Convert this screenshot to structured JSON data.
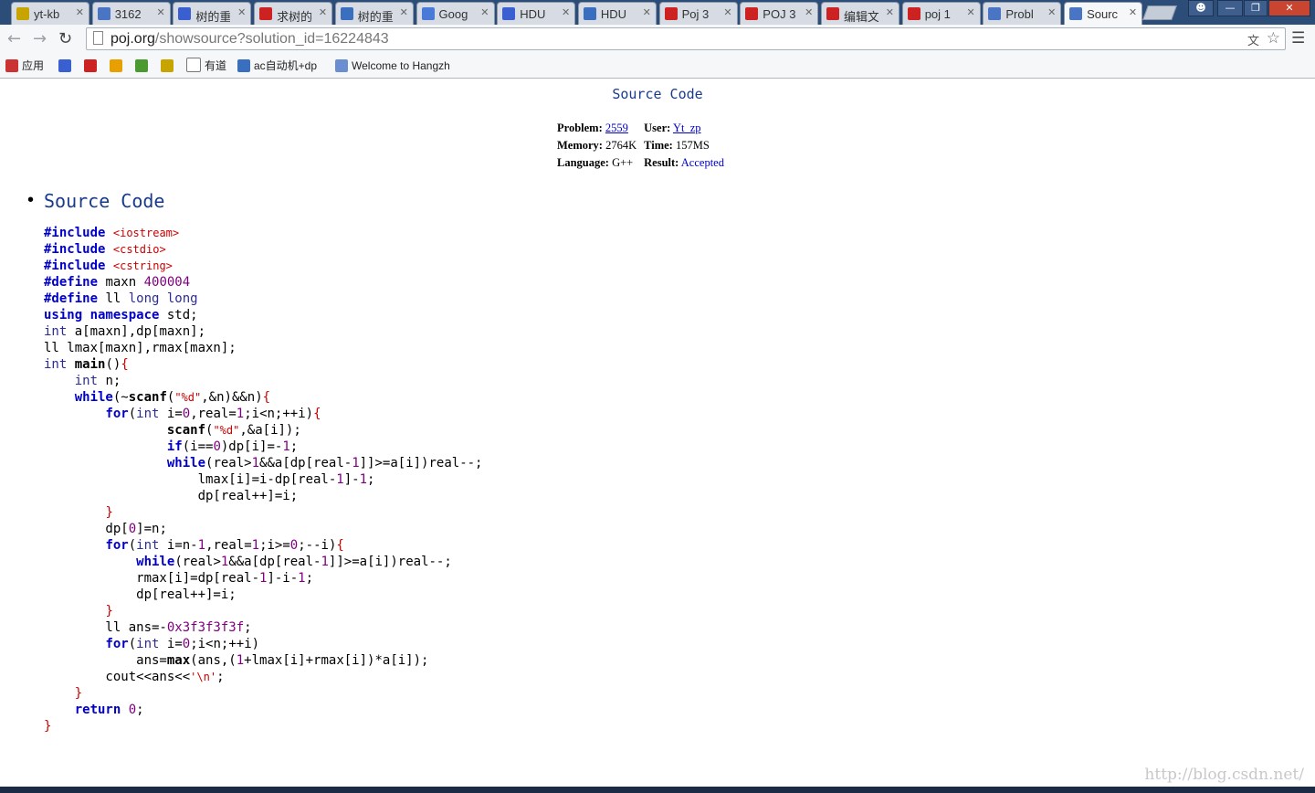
{
  "browser": {
    "tabs": [
      {
        "title": "yt-kb",
        "icon": "smiley-icon",
        "color": "#c8a400"
      },
      {
        "title": "3162",
        "icon": "poj-icon",
        "color": "#4a74c4"
      },
      {
        "title": "树的重",
        "icon": "paw-icon",
        "color": "#3a5fd0"
      },
      {
        "title": "求树的",
        "icon": "csdn-icon",
        "color": "#cc2222"
      },
      {
        "title": "树的重",
        "icon": "browser-icon",
        "color": "#3a6fc0"
      },
      {
        "title": "Goog",
        "icon": "google-translate-icon",
        "color": "#4a7ad8"
      },
      {
        "title": "HDU",
        "icon": "paw-icon",
        "color": "#3a5fd0"
      },
      {
        "title": "HDU",
        "icon": "browser-icon",
        "color": "#3a6fc0"
      },
      {
        "title": "Poj 3",
        "icon": "csdn-icon",
        "color": "#cc2222"
      },
      {
        "title": "POJ 3",
        "icon": "csdn-icon",
        "color": "#cc2222"
      },
      {
        "title": "编辑文",
        "icon": "csdn-icon",
        "color": "#cc2222"
      },
      {
        "title": "poj 1",
        "icon": "csdn-icon",
        "color": "#cc2222"
      },
      {
        "title": "Probl",
        "icon": "poj-icon",
        "color": "#4a74c4"
      },
      {
        "title": "Sourc",
        "icon": "poj-icon",
        "color": "#4a74c4",
        "active": true
      }
    ],
    "url_host": "poj.org",
    "url_path": "/showsource?solution_id=16224843",
    "bookmarks": [
      {
        "label": "应用",
        "icon": "apps-grid-icon"
      },
      {
        "label": "",
        "icon": "paw-icon"
      },
      {
        "label": "",
        "icon": "csdn-icon"
      },
      {
        "label": "",
        "icon": "swirl-icon"
      },
      {
        "label": "",
        "icon": "leaf-icon"
      },
      {
        "label": "",
        "icon": "smiley-icon"
      },
      {
        "label": "有道",
        "icon": "page-icon"
      },
      {
        "label": "ac自动机+dp",
        "icon": "browser-icon"
      },
      {
        "label": "Welcome to Hangzh",
        "icon": "globe-icon"
      }
    ]
  },
  "page": {
    "heading": "Source Code",
    "info": {
      "problem_label": "Problem:",
      "problem_value": "2559",
      "user_label": "User:",
      "user_value": "Yt_zp",
      "memory_label": "Memory:",
      "memory_value": "2764K",
      "time_label": "Time:",
      "time_value": "157MS",
      "language_label": "Language:",
      "language_value": "G++",
      "result_label": "Result:",
      "result_value": "Accepted"
    },
    "section_title": "Source Code",
    "watermark": "http://blog.csdn.net/"
  }
}
